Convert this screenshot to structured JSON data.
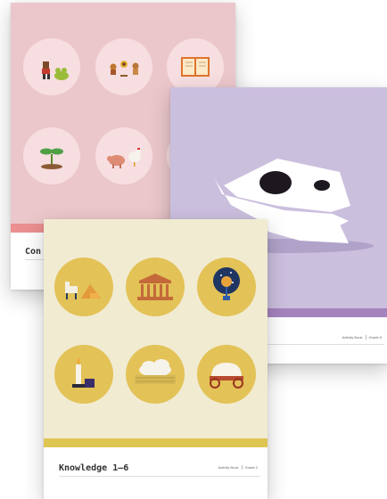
{
  "books": [
    {
      "title": "Con",
      "color": "#ebc7cb"
    },
    {
      "title": "",
      "color": "#cbbfde",
      "label_book": "Activity Book",
      "label_grade": "Grade 5"
    },
    {
      "title": "Knowledge 1–6",
      "color": "#f1ebd2",
      "label_book": "Activity Book",
      "label_grade": "Grade 2"
    }
  ]
}
